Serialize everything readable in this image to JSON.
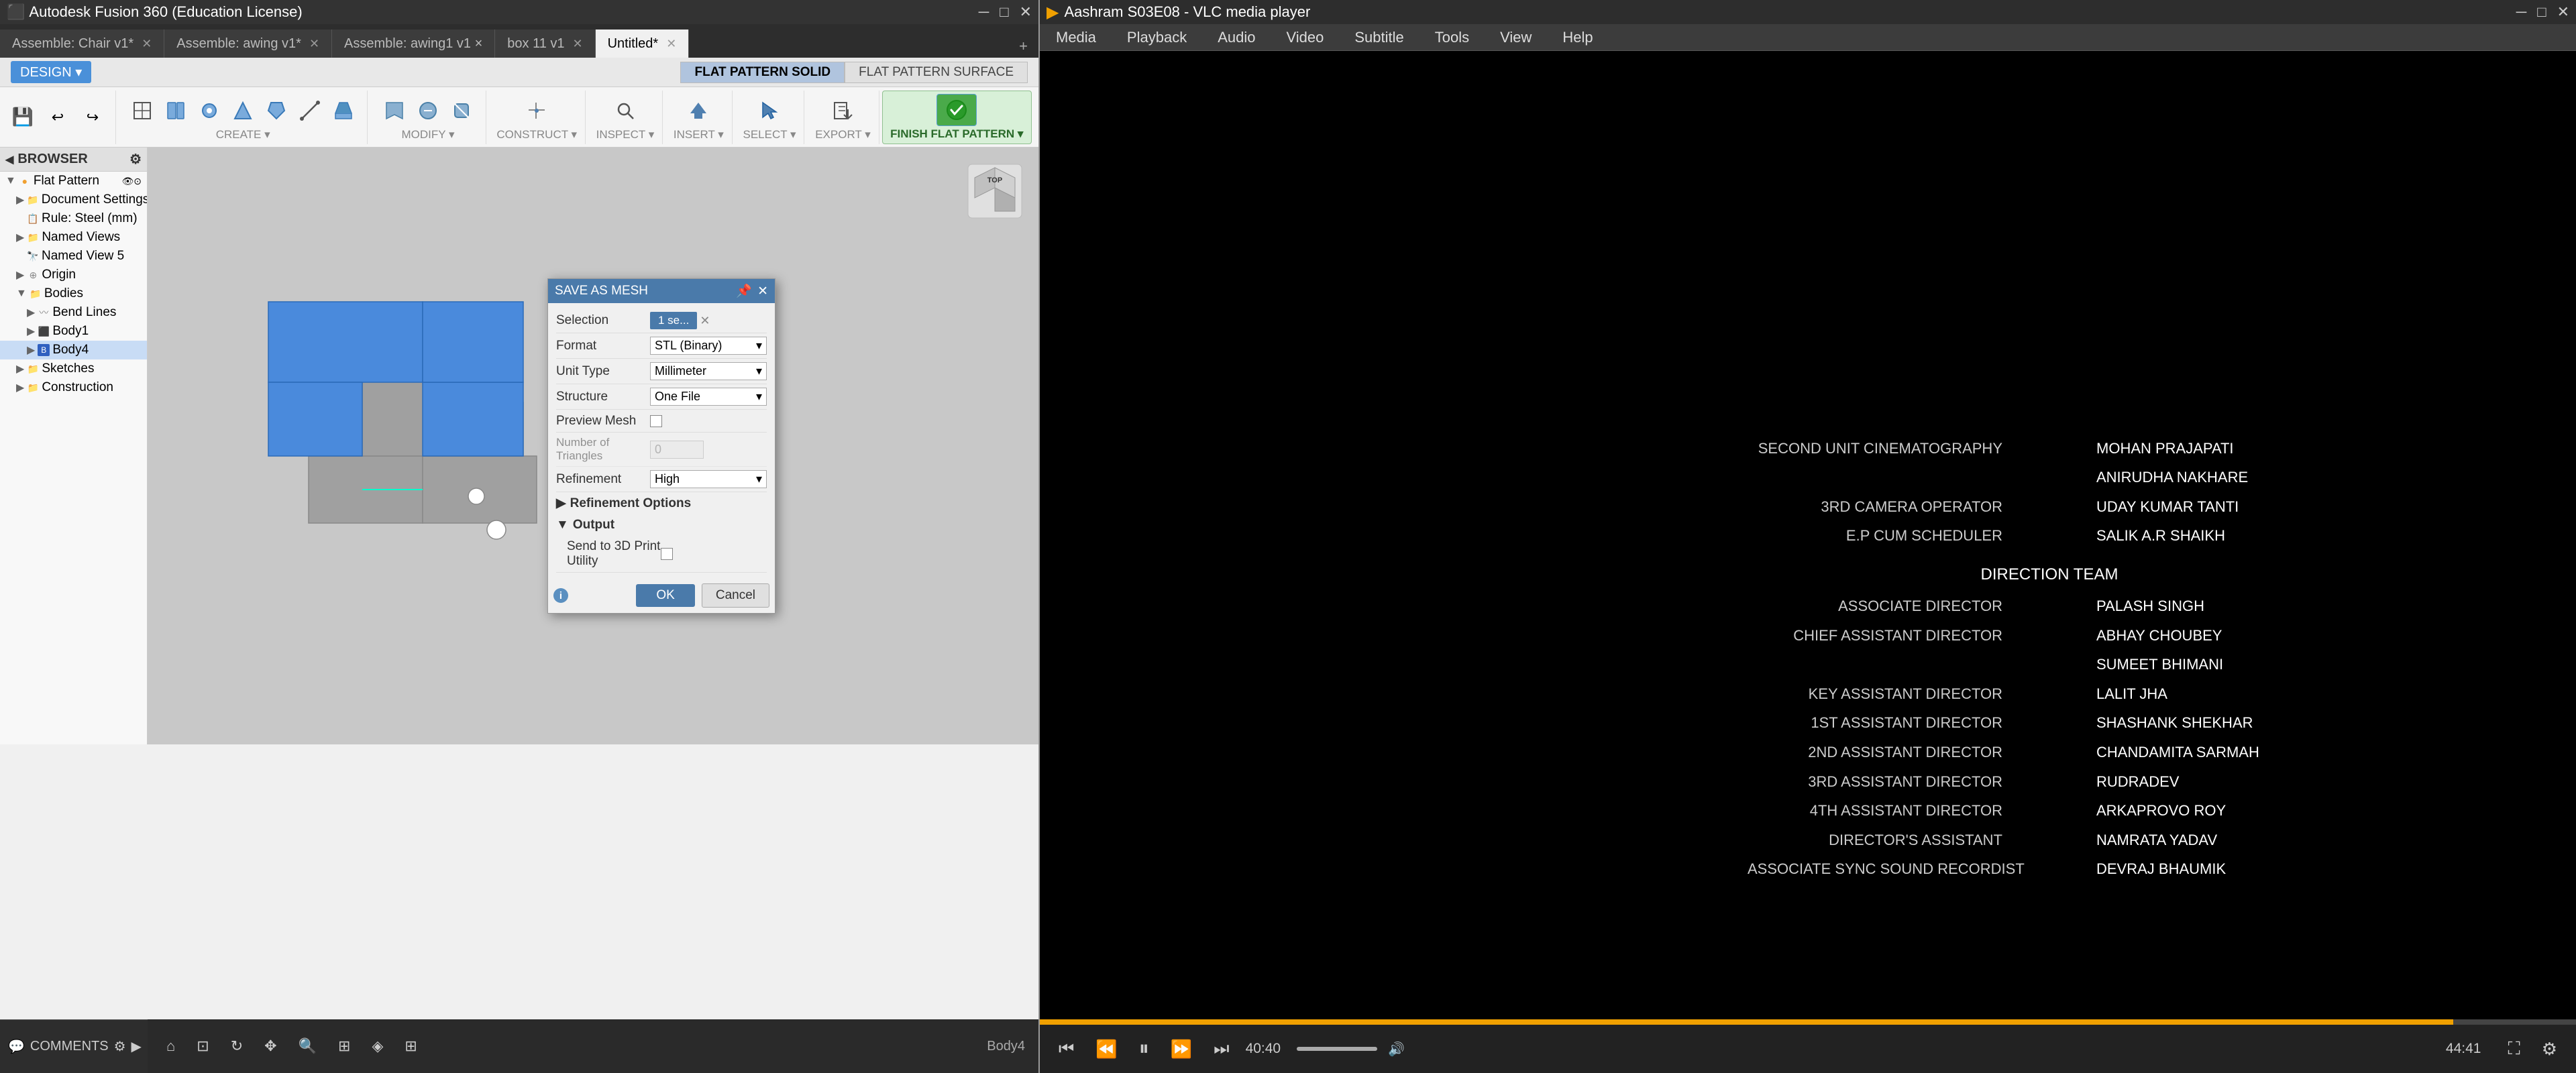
{
  "fusion": {
    "title_bar": "Autodesk Fusion 360 (Education License)",
    "tabs": [
      {
        "label": "Assemble: Chair v1*",
        "active": false,
        "closable": true
      },
      {
        "label": "Assemble: awing v1*",
        "active": false,
        "closable": true
      },
      {
        "label": "Assemble: awing1 v1 ×",
        "active": false,
        "closable": true
      },
      {
        "label": "box 11 v1",
        "active": false,
        "closable": true
      },
      {
        "label": "Untitled*",
        "active": true,
        "closable": true
      }
    ],
    "design_btn": "DESIGN ▾",
    "flat_pattern_tabs": [
      {
        "label": "FLAT PATTERN SOLID",
        "active": true
      },
      {
        "label": "FLAT PATTERN SURFACE",
        "active": false
      }
    ],
    "toolbar_groups": [
      {
        "label": "CREATE ▾",
        "tools": [
          "rect",
          "shape1",
          "shape2",
          "shape3",
          "shape4",
          "shape5",
          "shape6"
        ]
      },
      {
        "label": "MODIFY ▾",
        "tools": [
          "mod1",
          "mod2",
          "mod3"
        ]
      },
      {
        "label": "CONSTRUCT ▾",
        "tools": [
          "con1"
        ]
      },
      {
        "label": "INSPECT ▾",
        "tools": [
          "ins1"
        ]
      },
      {
        "label": "INSERT ▾",
        "tools": [
          "ins2"
        ]
      },
      {
        "label": "SELECT ▾",
        "tools": [
          "sel1"
        ]
      },
      {
        "label": "EXPORT ▾",
        "tools": [
          "exp1"
        ]
      },
      {
        "label": "FINISH FLAT PATTERN ▾",
        "tools": [
          "fin1"
        ],
        "active": true
      }
    ],
    "browser": {
      "header": "BROWSER",
      "items": [
        {
          "label": "Flat Pattern",
          "level": 0,
          "type": "root",
          "expanded": true
        },
        {
          "label": "Document Settings",
          "level": 1,
          "type": "folder"
        },
        {
          "label": "Rule: Steel (mm)",
          "level": 2,
          "type": "rule"
        },
        {
          "label": "Named Views",
          "level": 1,
          "type": "folder"
        },
        {
          "label": "Named View 5",
          "level": 2,
          "type": "view"
        },
        {
          "label": "Origin",
          "level": 2,
          "type": "origin"
        },
        {
          "label": "Bodies",
          "level": 1,
          "type": "folder",
          "expanded": true
        },
        {
          "label": "Bend Lines",
          "level": 2,
          "type": "bendlines"
        },
        {
          "label": "Body1",
          "level": 2,
          "type": "body"
        },
        {
          "label": "Body4",
          "level": 2,
          "type": "body",
          "selected": true
        },
        {
          "label": "Sketches",
          "level": 1,
          "type": "folder"
        },
        {
          "label": "Construction",
          "level": 1,
          "type": "folder"
        }
      ]
    },
    "dialog": {
      "title": "SAVE AS MESH",
      "fields": {
        "selection_label": "Selection",
        "selection_btn": "1 se...",
        "format_label": "Format",
        "format_value": "STL (Binary)",
        "unit_type_label": "Unit Type",
        "unit_type_value": "Millimeter",
        "structure_label": "Structure",
        "structure_value": "One File",
        "preview_mesh_label": "Preview Mesh",
        "num_triangles_label": "Number of Triangles",
        "num_triangles_value": "0",
        "refinement_label": "Refinement",
        "refinement_value": "High",
        "refinement_options_label": "Refinement Options",
        "output_label": "Output",
        "send_to_3d_label": "Send to 3D Print Utility",
        "ok_btn": "OK",
        "cancel_btn": "Cancel"
      }
    },
    "status": {
      "comments_label": "COMMENTS",
      "body_label": "Body4"
    }
  },
  "vlc": {
    "title": "Aashram S03E08 - VLC media player",
    "menu_items": [
      "Media",
      "Playback",
      "Audio",
      "Video",
      "Subtitle",
      "Tools",
      "View",
      "Help"
    ],
    "credits": {
      "sections": [
        {
          "heading": "",
          "rows": [
            {
              "left": "SECOND UNIT CINEMATOGRAPHY",
              "right": "MOHAN PRAJAPATI"
            },
            {
              "left": "",
              "right": "ANIRUDHA NAKHARE"
            },
            {
              "left": "3RD CAMERA OPERATOR",
              "right": "UDAY KUMAR TANTI"
            },
            {
              "left": "E.P CUM SCHEDULER",
              "right": "SALIK A.R SHAIKH"
            }
          ]
        },
        {
          "heading": "DIRECTION TEAM",
          "rows": [
            {
              "left": "ASSOCIATE DIRECTOR",
              "right": "PALASH SINGH"
            },
            {
              "left": "CHIEF ASSISTANT DIRECTOR",
              "right": "ABHAY CHOUBEY"
            },
            {
              "left": "",
              "right": "SUMEET BHIMANI"
            },
            {
              "left": "KEY ASSISTANT DIRECTOR",
              "right": "LALIT JHA"
            },
            {
              "left": "1ST ASSISTANT DIRECTOR",
              "right": "SHASHANK SHEKHAR"
            },
            {
              "left": "2ND ASSISTANT DIRECTOR",
              "right": "CHANDAMITA SARMAH"
            },
            {
              "left": "3RD ASSISTANT DIRECTOR",
              "right": "RUDRADEV"
            },
            {
              "left": "4TH ASSISTANT DIRECTOR",
              "right": "ARKAPROVO ROY"
            },
            {
              "left": "DIRECTOR'S ASSISTANT",
              "right": "NAMRATA YADAV"
            },
            {
              "left": "ASSOCIATE SYNC SOUND RECORDIST",
              "right": "DEVRAJ BHAUMIK"
            }
          ]
        }
      ]
    },
    "progress": {
      "current": "40:40",
      "total": "44:41",
      "percent": 92
    }
  }
}
